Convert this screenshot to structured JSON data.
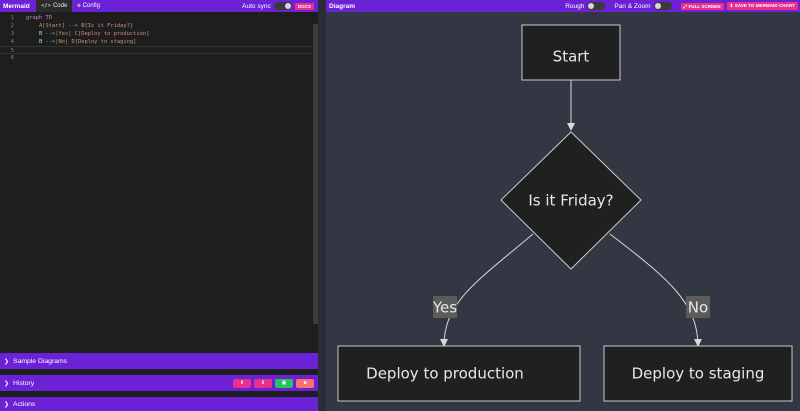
{
  "left": {
    "brand": "Mermaid",
    "tabs": [
      {
        "label": "Code",
        "icon": "code-icon"
      },
      {
        "label": "Config",
        "icon": "config-icon"
      }
    ],
    "auto_sync_label": "Auto sync",
    "docs_label": "DOCS",
    "code_lines": [
      {
        "num": "1",
        "parts": [
          {
            "t": "graph TD",
            "c": "kw"
          }
        ]
      },
      {
        "num": "2",
        "parts": [
          {
            "t": "    A[Start] ",
            "c": "txt"
          },
          {
            "t": "-->",
            "c": "arr"
          },
          {
            "t": " B{Is it Friday?}",
            "c": "txt"
          }
        ]
      },
      {
        "num": "3",
        "parts": [
          {
            "t": "    B ",
            "c": "id"
          },
          {
            "t": "-->",
            "c": "arr"
          },
          {
            "t": "|Yes| C[Deploy to production]",
            "c": "txt"
          }
        ]
      },
      {
        "num": "4",
        "parts": [
          {
            "t": "    B ",
            "c": "id"
          },
          {
            "t": "-->",
            "c": "arr"
          },
          {
            "t": "|No| D[Deploy to staging]",
            "c": "txt"
          }
        ]
      },
      {
        "num": "5",
        "parts": []
      },
      {
        "num": "6",
        "parts": []
      }
    ],
    "sections": {
      "sample": "Sample Diagrams",
      "history": "History",
      "actions": "Actions"
    },
    "history_buttons": [
      {
        "icon": "upload-icon",
        "color": "#e8308c"
      },
      {
        "icon": "download-icon",
        "color": "#e8308c"
      },
      {
        "icon": "save-icon",
        "color": "#22c55e"
      },
      {
        "icon": "trash-icon",
        "color": "#f87171"
      }
    ]
  },
  "right": {
    "title": "Diagram",
    "rough_label": "Rough",
    "pan_zoom_label": "Pan & Zoom",
    "full_screen_label": "FULL SCREEN",
    "save_label": "SAVE TO MERMAID CHART"
  },
  "diagram": {
    "nodes": {
      "start": "Start",
      "decision": "Is it Friday?",
      "production": "Deploy to production",
      "staging": "Deploy to staging"
    },
    "edges": {
      "yes": "Yes",
      "no": "No"
    }
  },
  "colors": {
    "accent": "#6b21d6",
    "pink": "#e8308c",
    "canvas": "#333643",
    "node_fill": "#1f2020"
  }
}
